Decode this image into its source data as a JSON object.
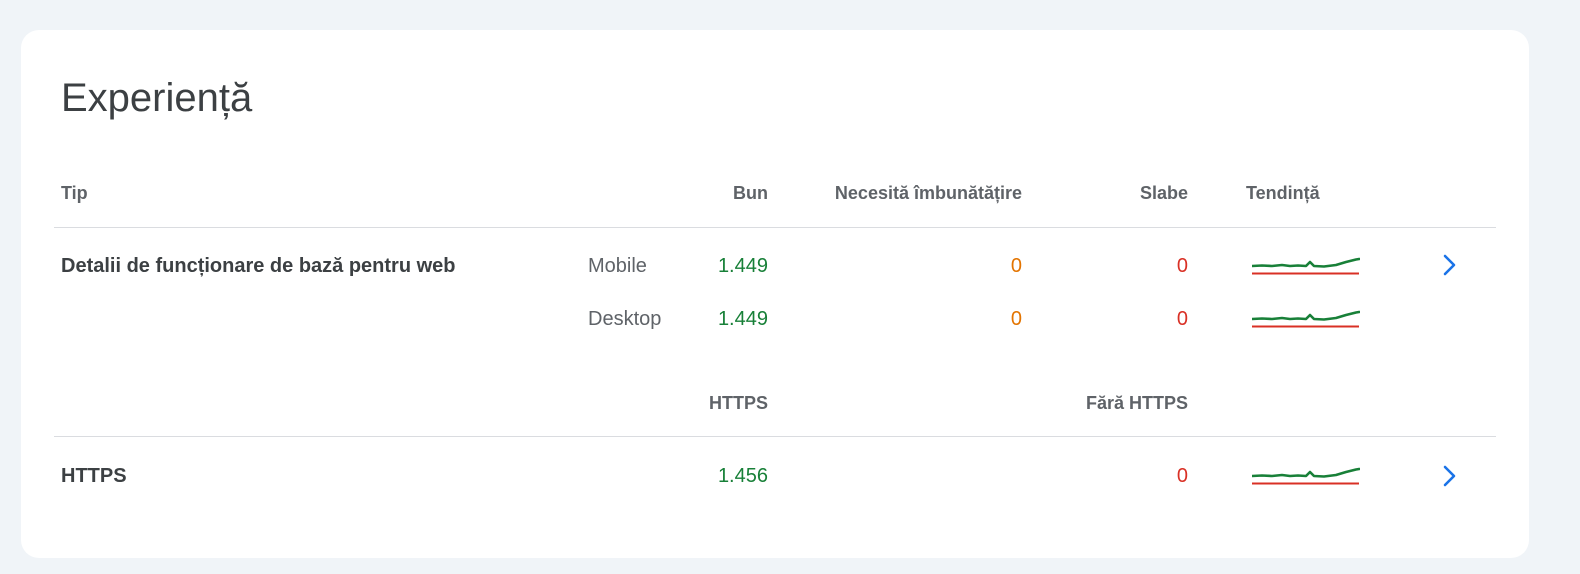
{
  "card": {
    "title": "Experiență"
  },
  "table": {
    "headers": {
      "type": "Tip",
      "good": "Bun",
      "needs_improvement": "Necesită îmbunătățire",
      "poor": "Slabe",
      "trend": "Tendință"
    },
    "cwv": {
      "label": "Detalii de funcționare de bază pentru web",
      "rows": [
        {
          "device": "Mobile",
          "good": "1.449",
          "needs_improvement": "0",
          "poor": "0"
        },
        {
          "device": "Desktop",
          "good": "1.449",
          "needs_improvement": "0",
          "poor": "0"
        }
      ]
    },
    "https_headers": {
      "https": "HTTPS",
      "no_https": "Fără HTTPS"
    },
    "https": {
      "label": "HTTPS",
      "https": "1.456",
      "no_https": "0"
    }
  },
  "colors": {
    "good": "#188038",
    "warn": "#e37400",
    "bad": "#d93025",
    "link": "#1a73e8"
  },
  "icons": {
    "open": "chevron-right-icon",
    "trend": "sparkline-chart"
  }
}
